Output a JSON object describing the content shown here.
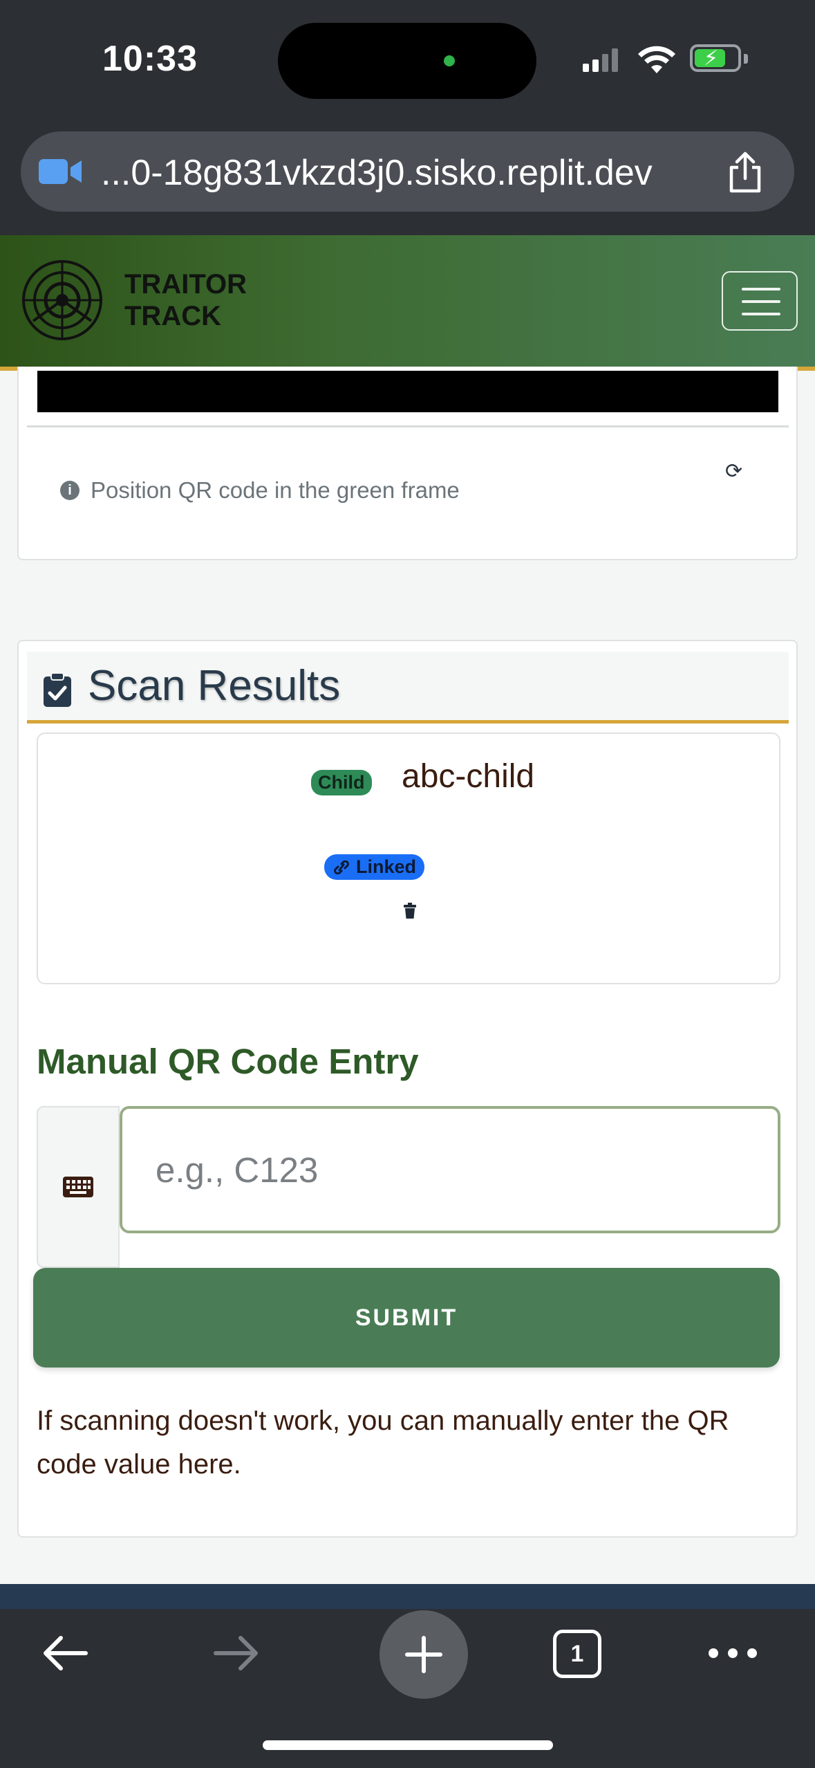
{
  "status_bar": {
    "time": "10:33"
  },
  "browser": {
    "url": "...0-18g831vkzd3j0.sisko.replit.dev",
    "tab_count": "1"
  },
  "app": {
    "brand_line1": "TRAITOR",
    "brand_line2": "TRACK"
  },
  "scanner": {
    "hint": "Position QR code in the green frame"
  },
  "results": {
    "title": "Scan Results",
    "item": {
      "type_badge": "Child",
      "code": "abc-child",
      "status_badge": "Linked"
    }
  },
  "manual_entry": {
    "title": "Manual QR Code Entry",
    "input_value": "",
    "placeholder": "e.g., C123",
    "submit_label": "SUBMIT",
    "help": "If scanning doesn't work, you can manually enter the QR code value here."
  },
  "colors": {
    "accent_green": "#4a7d55",
    "header_gold": "#d6a63a",
    "child_badge": "#2e8b57",
    "linked_badge": "#1a6ef5"
  },
  "icons": [
    "video-camera-icon",
    "share-icon",
    "radar-logo-icon",
    "hamburger-menu-icon",
    "info-icon",
    "refresh-icon",
    "clipboard-check-icon",
    "link-icon",
    "trash-icon",
    "keyboard-icon",
    "back-arrow-icon",
    "forward-arrow-icon",
    "plus-icon",
    "tabs-icon",
    "more-icon"
  ]
}
